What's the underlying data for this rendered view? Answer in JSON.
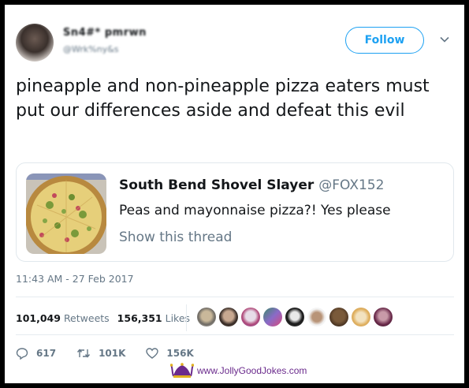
{
  "tweet": {
    "display_name": "Sn4#* pmrwn",
    "handle": "@Wrk%ny&s",
    "follow_label": "Follow",
    "text": "pineapple and non-pineapple pizza eaters must put our differences aside and defeat this evil",
    "timestamp": "11:43 AM - 27 Feb 2017"
  },
  "quoted": {
    "author_name": "South Bend Shovel Slayer",
    "author_handle": "@FOX152",
    "text": "Peas and mayonnaise pizza?! Yes please",
    "show_thread": "Show this thread",
    "image": "pizza-photo"
  },
  "stats": {
    "retweets_count": "101,049",
    "retweets_label": "Retweets",
    "likes_count": "156,351",
    "likes_label": "Likes",
    "liker_avatars": 9
  },
  "actions": {
    "replies": "617",
    "retweets": "101K",
    "likes": "156K"
  },
  "icons": {
    "reply": "reply-icon",
    "retweet": "retweet-icon",
    "like": "heart-icon",
    "menu": "chevron-down-icon"
  },
  "watermark": {
    "text": "www.JollyGoodJokes.com"
  },
  "colors": {
    "accent": "#1da1f2",
    "text_primary": "#14171a",
    "text_secondary": "#657786",
    "watermark": "#6a2a8c"
  }
}
